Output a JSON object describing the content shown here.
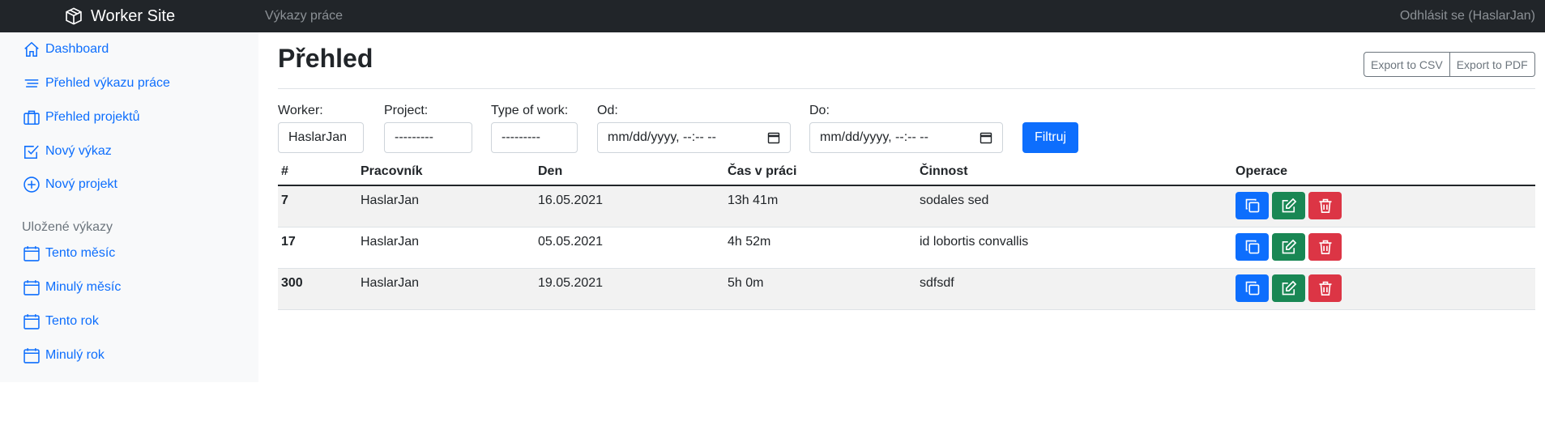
{
  "topbar": {
    "brand": "Worker Site",
    "title": "Výkazy práce",
    "logout": "Odhlásit se (HaslarJan)"
  },
  "sidebar": {
    "items": [
      {
        "label": "Dashboard",
        "icon": "house-icon"
      },
      {
        "label": "Přehled výkazu práce",
        "icon": "lines-icon"
      },
      {
        "label": "Přehled projektů",
        "icon": "briefcase-icon"
      },
      {
        "label": "Nový výkaz",
        "icon": "check-square-icon"
      },
      {
        "label": "Nový projekt",
        "icon": "plus-circle-icon"
      }
    ],
    "saved_heading": "Uložené výkazy",
    "saved_items": [
      {
        "label": "Tento měsíc",
        "icon": "calendar-icon"
      },
      {
        "label": "Minulý měsíc",
        "icon": "calendar-icon"
      },
      {
        "label": "Tento rok",
        "icon": "calendar-icon"
      },
      {
        "label": "Minulý rok",
        "icon": "calendar-icon"
      }
    ]
  },
  "main": {
    "title": "Přehled",
    "export_csv": "Export to CSV",
    "export_pdf": "Export to PDF",
    "filters": {
      "worker_label": "Worker:",
      "worker_value": "HaslarJan",
      "project_label": "Project:",
      "project_value": "---------",
      "type_label": "Type of work:",
      "type_value": "---------",
      "od_label": "Od:",
      "od_value": "mm/dd/yyyy, --:-- --",
      "do_label": "Do:",
      "do_value": "mm/dd/yyyy, --:-- --",
      "submit": "Filtruj"
    },
    "table": {
      "headers": [
        "#",
        "Pracovník",
        "Den",
        "Čas v práci",
        "Činnost",
        "Operace"
      ],
      "rows": [
        {
          "id": "7",
          "worker": "HaslarJan",
          "day": "16.05.2021",
          "time": "13h 41m",
          "activity": "sodales sed"
        },
        {
          "id": "17",
          "worker": "HaslarJan",
          "day": "05.05.2021",
          "time": "4h 52m",
          "activity": "id lobortis convallis"
        },
        {
          "id": "300",
          "worker": "HaslarJan",
          "day": "19.05.2021",
          "time": "5h 0m",
          "activity": "sdfsdf"
        }
      ]
    }
  },
  "colors": {
    "primary": "#0d6efd",
    "success": "#198754",
    "danger": "#dc3545",
    "dark": "#212529"
  }
}
